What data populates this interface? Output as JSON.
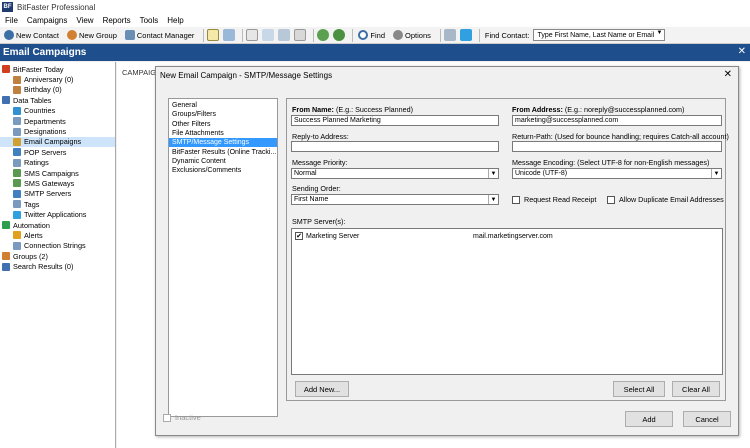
{
  "window": {
    "title": "BitFaster Professional",
    "logo": "BF"
  },
  "menu": [
    "File",
    "Campaigns",
    "View",
    "Reports",
    "Tools",
    "Help"
  ],
  "toolbar": {
    "new_contact": "New Contact",
    "new_group": "New Group",
    "contact_manager": "Contact Manager",
    "find": "Find",
    "options": "Options",
    "find_contact_label": "Find Contact:",
    "find_contact_placeholder": "Type First Name, Last Name or Email"
  },
  "section": {
    "title": "Email Campaigns",
    "close": "✕"
  },
  "tree": [
    {
      "label": "BitFaster Today",
      "indent": 1,
      "color": "#d04020"
    },
    {
      "label": "Anniversary (0)",
      "indent": 3,
      "color": "#c08040"
    },
    {
      "label": "Birthday (0)",
      "indent": 3,
      "color": "#c08040"
    },
    {
      "label": "Data Tables",
      "indent": 1,
      "color": "#4070b0"
    },
    {
      "label": "Countries",
      "indent": 3,
      "color": "#3090d0"
    },
    {
      "label": "Departments",
      "indent": 3,
      "color": "#7a9ac0"
    },
    {
      "label": "Designations",
      "indent": 3,
      "color": "#7a9ac0"
    },
    {
      "label": "Email Campaigns",
      "indent": 3,
      "color": "#d0a030",
      "selected": true
    },
    {
      "label": "POP Servers",
      "indent": 3,
      "color": "#4080c0"
    },
    {
      "label": "Ratings",
      "indent": 3,
      "color": "#7a9ac0"
    },
    {
      "label": "SMS Campaigns",
      "indent": 3,
      "color": "#5a9a50"
    },
    {
      "label": "SMS Gateways",
      "indent": 3,
      "color": "#5a9a50"
    },
    {
      "label": "SMTP Servers",
      "indent": 3,
      "color": "#4080c0"
    },
    {
      "label": "Tags",
      "indent": 3,
      "color": "#7a9ac0"
    },
    {
      "label": "Twitter Applications",
      "indent": 3,
      "color": "#30a0e0"
    },
    {
      "label": "Automation",
      "indent": 1,
      "color": "#2e9e4e"
    },
    {
      "label": "Alerts",
      "indent": 3,
      "color": "#e0a020"
    },
    {
      "label": "Connection Strings",
      "indent": 3,
      "color": "#7a9ac0"
    },
    {
      "label": "Groups (2)",
      "indent": 1,
      "color": "#d08030"
    },
    {
      "label": "Search Results (0)",
      "indent": 1,
      "color": "#4070b0"
    }
  ],
  "main": {
    "column_header": "CAMPAIGN"
  },
  "dialog": {
    "title": "New Email Campaign - SMTP/Message Settings",
    "close": "✕",
    "nav": [
      "General",
      "Groups/Filters",
      "Other Filters",
      "File Attachments",
      "SMTP/Message Settings",
      "BitFaster Results (Online Tracki...",
      "Dynamic Content",
      "Exclusions/Comments"
    ],
    "nav_selected": 4,
    "from_name_label": "From Name:",
    "from_name_hint": "(E.g.: Success Planned)",
    "from_name_value": "Success Planned Marketing",
    "from_address_label": "From Address:",
    "from_address_hint": "(E.g.: noreply@successplanned.com)",
    "from_address_value": "marketing@successplanned.com",
    "reply_to_label": "Reply-to Address:",
    "reply_to_value": "",
    "return_path_label": "Return-Path: (Used for bounce handling; requires Catch-all account)",
    "return_path_value": "",
    "priority_label": "Message Priority:",
    "priority_value": "Normal",
    "encoding_label": "Message Encoding:  (Select UTF-8 for non-English messages)",
    "encoding_value": "Unicode (UTF-8)",
    "sending_order_label": "Sending Order:",
    "sending_order_value": "First Name",
    "request_read_receipt": "Request Read Receipt",
    "allow_duplicates": "Allow Duplicate Email Addresses",
    "smtp_servers_label": "SMTP Server(s):",
    "smtp_servers": [
      {
        "name": "Marketing Server",
        "host": "mail.marketingserver.com",
        "checked": true
      }
    ],
    "add_new": "Add New...",
    "select_all": "Select All",
    "clear_all": "Clear All",
    "inactive": "Inactive",
    "add": "Add",
    "cancel": "Cancel"
  }
}
